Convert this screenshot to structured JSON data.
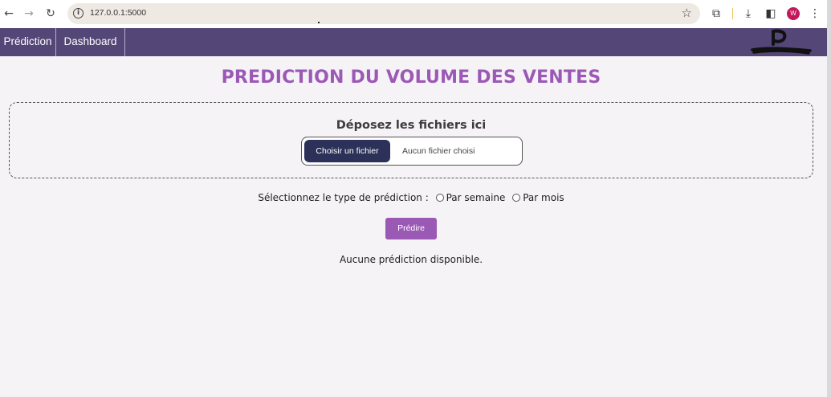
{
  "browser": {
    "url": "127.0.0.1:5000",
    "avatar_letter": "W",
    "icons": [
      "back-arrow-icon",
      "forward-arrow-icon",
      "reload-icon",
      "site-info-icon",
      "star-icon",
      "extensions-icon",
      "download-icon",
      "side-panel-icon",
      "kebab-menu-icon"
    ]
  },
  "navbar": {
    "items": [
      {
        "label": "Prédiction"
      },
      {
        "label": "Dashboard"
      }
    ],
    "color": "#544677"
  },
  "main": {
    "title": "PREDICTION DU VOLUME DES VENTES",
    "title_color": "#9b59b6",
    "dropzone": {
      "title": "Déposez les fichiers ici",
      "button_label": "Choisir un fichier",
      "status": "Aucun fichier choisi"
    },
    "prediction_type": {
      "label": "Sélectionnez le type de prédiction :",
      "options": [
        {
          "label": "Par semaine",
          "checked": false
        },
        {
          "label": "Par mois",
          "checked": false
        }
      ]
    },
    "predict_button": "Prédire",
    "result_text": "Aucune prédiction disponible."
  }
}
